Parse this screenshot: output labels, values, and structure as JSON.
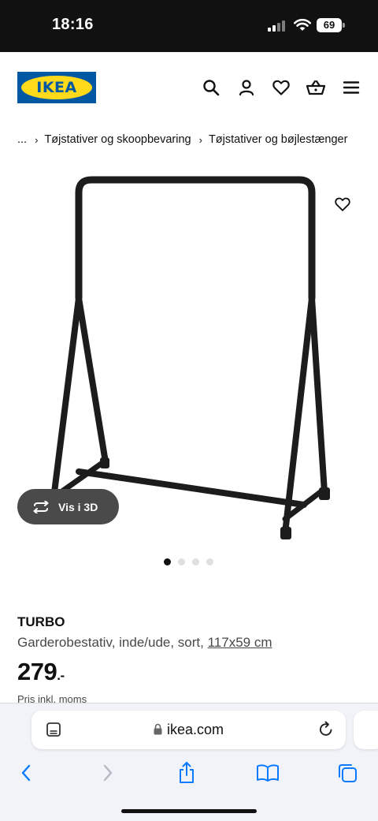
{
  "status_bar": {
    "time": "18:16",
    "battery": "69"
  },
  "header": {
    "logo_text": "IKEA",
    "icons": [
      "search-icon",
      "account-icon",
      "heart-icon",
      "basket-icon",
      "menu-icon"
    ]
  },
  "breadcrumb": {
    "ellipsis": "...",
    "items": [
      "Tøjstativer og skoopbevaring",
      "Tøjstativer og bøjlestænger"
    ]
  },
  "gallery": {
    "view_3d_label": "Vis i 3D",
    "image_count": 4,
    "active_index": 0
  },
  "product": {
    "name": "TURBO",
    "description": "Garderobestativ, inde/ude, sort, ",
    "size_link": "117x59 cm",
    "price": "279",
    "price_suffix": ".-",
    "price_note": "Pris inkl. moms"
  },
  "browser": {
    "domain": "ikea.com"
  },
  "colors": {
    "ikea_blue": "#0058a3",
    "ikea_yellow": "#ffda1a",
    "ios_blue": "#0a7aff",
    "pill_bg": "#4a4a4a"
  }
}
